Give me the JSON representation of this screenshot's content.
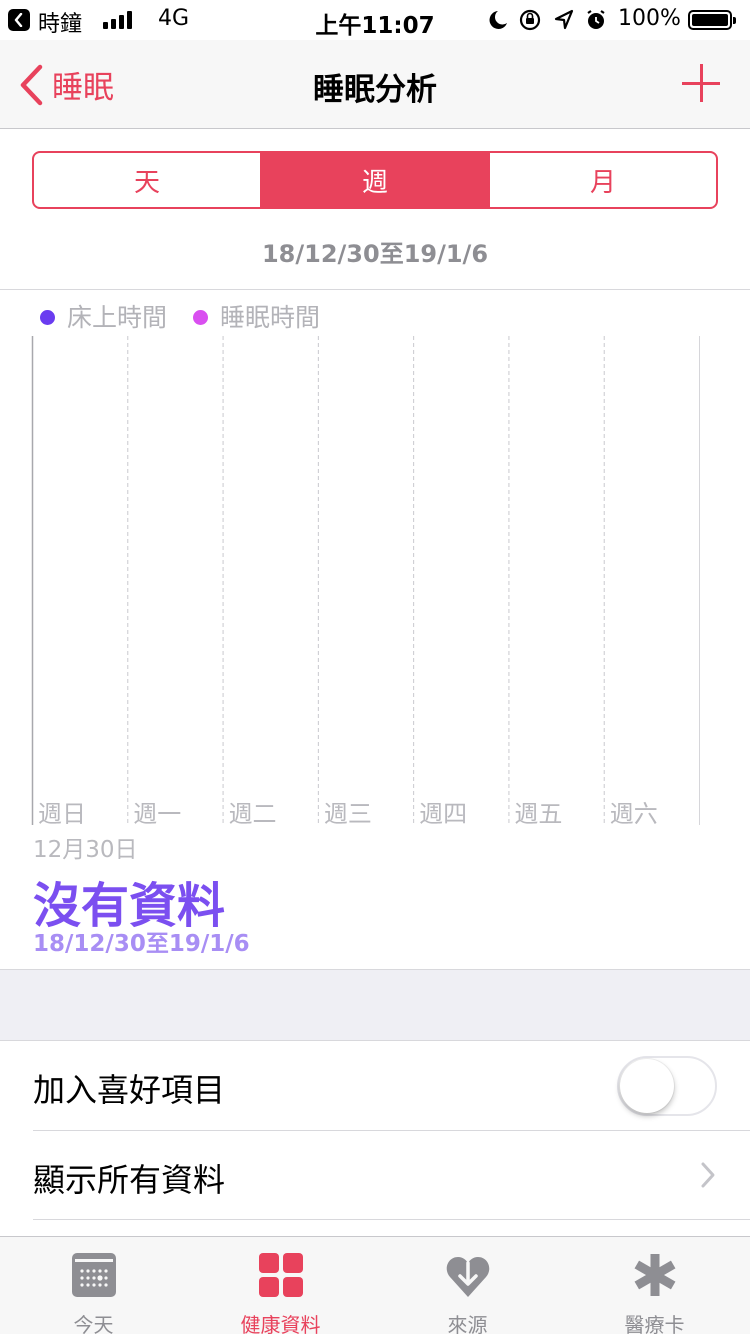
{
  "status_bar": {
    "back_app": "時鐘",
    "network": "4G",
    "time": "上午11:07",
    "battery_percent": "100%"
  },
  "nav": {
    "back_label": "睡眠",
    "title": "睡眠分析"
  },
  "segments": [
    {
      "label": "天",
      "active": false
    },
    {
      "label": "週",
      "active": true
    },
    {
      "label": "月",
      "active": false
    }
  ],
  "date_range": "18/12/30至19/1/6",
  "legend": [
    {
      "label": "床上時間",
      "color": "#6a3cf0"
    },
    {
      "label": "睡眠時間",
      "color": "#d94ff0"
    }
  ],
  "chart_data": {
    "type": "bar",
    "categories": [
      "週日",
      "週一",
      "週二",
      "週三",
      "週四",
      "週五",
      "週六"
    ],
    "series": [
      {
        "name": "床上時間",
        "values": [
          null,
          null,
          null,
          null,
          null,
          null,
          null
        ]
      },
      {
        "name": "睡眠時間",
        "values": [
          null,
          null,
          null,
          null,
          null,
          null,
          null
        ]
      }
    ],
    "grid": true
  },
  "selection": {
    "date": "12月30日",
    "value": "沒有資料",
    "range": "18/12/30至19/1/6"
  },
  "list": {
    "favorite_label": "加入喜好項目",
    "favorite_on": false,
    "show_all_label": "顯示所有資料"
  },
  "tabs": [
    {
      "label": "今天",
      "icon": "today-icon",
      "active": false
    },
    {
      "label": "健康資料",
      "icon": "health-data-icon",
      "active": true
    },
    {
      "label": "來源",
      "icon": "sources-icon",
      "active": false
    },
    {
      "label": "醫療卡",
      "icon": "medical-id-icon",
      "active": false
    }
  ],
  "colors": {
    "accent": "#e8425c",
    "purple": "#7b4ff0"
  }
}
